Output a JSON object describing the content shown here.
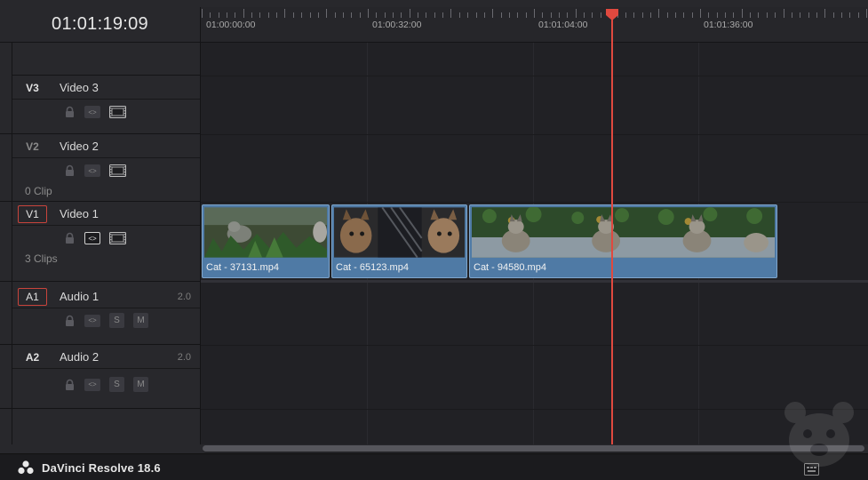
{
  "timecode": "01:01:19:09",
  "ruler": {
    "labels": [
      "01:00:00:00",
      "01:00:32:00",
      "01:01:04:00",
      "01:01:36:00"
    ]
  },
  "tracks": {
    "v3": {
      "id": "V3",
      "name": "Video 3",
      "clip_count": ""
    },
    "v2": {
      "id": "V2",
      "name": "Video 2",
      "clip_count": "0 Clip"
    },
    "v1": {
      "id": "V1",
      "name": "Video 1",
      "clip_count": "3 Clips"
    },
    "a1": {
      "id": "A1",
      "name": "Audio 1",
      "channels": "2.0",
      "solo": "S",
      "mute": "M"
    },
    "a2": {
      "id": "A2",
      "name": "Audio 2",
      "channels": "2.0",
      "solo": "S",
      "mute": "M"
    }
  },
  "clips": [
    {
      "name": "Cat - 37131.mp4"
    },
    {
      "name": "Cat - 65123.mp4"
    },
    {
      "name": "Cat - 94580.mp4"
    }
  ],
  "app": {
    "name": "DaVinci Resolve 18.6"
  },
  "colors": {
    "clip": "#4f7aa5",
    "playhead": "#e0493f",
    "active_track_border": "#c9443c",
    "background": "#1f1f23"
  },
  "icons": {
    "lock": "lock-icon",
    "link": "auto-select-icon",
    "film": "video-toggle-icon",
    "logo": "davinci-resolve-logo-icon"
  }
}
